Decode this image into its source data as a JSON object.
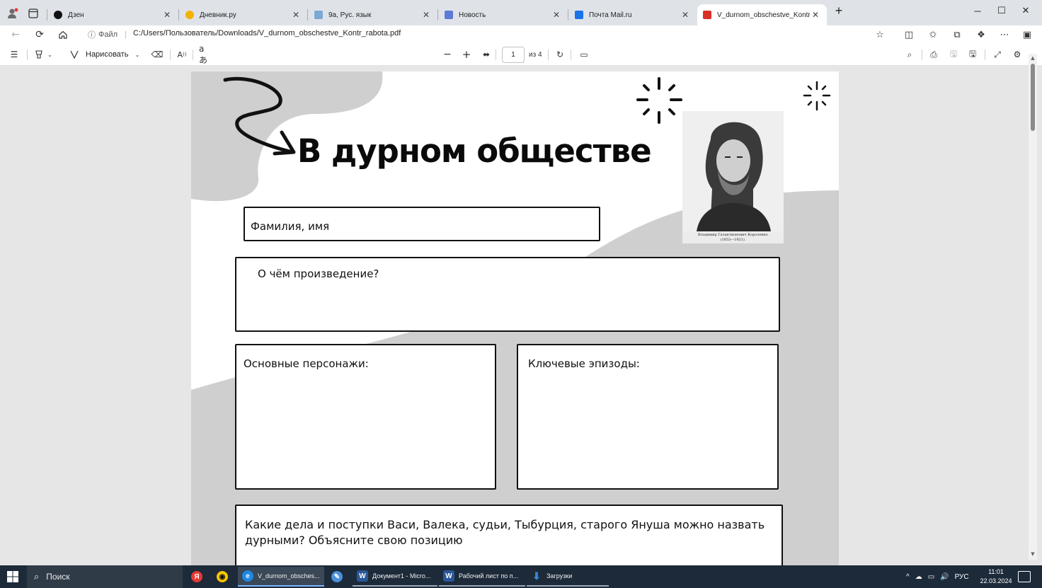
{
  "tabs": [
    {
      "label": "Дзен",
      "favicon_color": "#111111",
      "active": false
    },
    {
      "label": "Дневник.ру",
      "favicon_color": "#f2b200",
      "active": false
    },
    {
      "label": "9а, Рус. язык",
      "favicon_color": "#7aa9d6",
      "active": false
    },
    {
      "label": "Новость",
      "favicon_color": "#5b7bd5",
      "active": false
    },
    {
      "label": "Почта Mail.ru",
      "favicon_color": "#1a73e8",
      "active": false
    },
    {
      "label": "V_durnom_obschestve_Kontr_rab",
      "favicon_color": "#d9302a",
      "active": true
    }
  ],
  "address_bar": {
    "file_label": "Файл",
    "url": "C:/Users/Пользователь/Downloads/V_durnom_obschestve_Kontr_rabota.pdf"
  },
  "pdf_toolbar": {
    "draw_label": "Нарисовать",
    "current_page": "1",
    "page_of": "из 4"
  },
  "document": {
    "title": "В дурном обществе",
    "fields": {
      "name": "Фамилия, имя",
      "about": "О чём произведение?",
      "characters": "Основные персонажи:",
      "episodes": "Ключевые эпизоды:",
      "question_line1": "Какие дела и поступки Васи, Валека, судьи, Тыбурция, старого Януша можно назвать",
      "question_line2": "дурными? Объясните свою позицию"
    },
    "portrait_caption_line1": "Владимир Галактионович Короленко",
    "portrait_caption_line2": "(1853—1921)."
  },
  "taskbar": {
    "search_label": "Поиск",
    "apps": [
      {
        "label": "V_durnom_obsches...",
        "icon_color": "#1e88e5",
        "state": "active"
      },
      {
        "label": "Документ1 - Micro...",
        "icon_color": "#2b5797",
        "state": "running"
      },
      {
        "label": "Рабочий лист по п...",
        "icon_color": "#2b5797",
        "state": "running"
      },
      {
        "label": "Загрузки",
        "icon_color": "#3a86d6",
        "state": "running"
      }
    ],
    "language": "РУС",
    "time": "11:01",
    "date": "22.03.2024"
  }
}
